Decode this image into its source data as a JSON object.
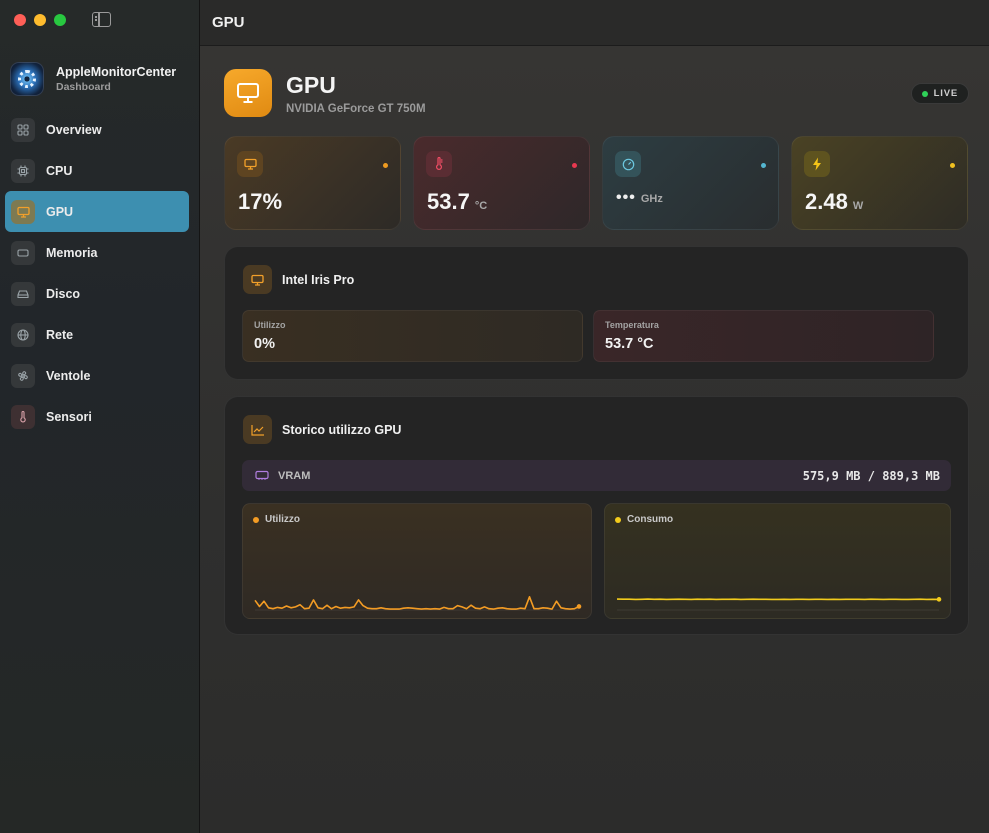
{
  "window": {
    "traffic_lights": [
      "close",
      "minimize",
      "zoom"
    ],
    "toolbar_title": "GPU"
  },
  "sidebar": {
    "app_name": "AppleMonitorCenter",
    "app_subtitle": "Dashboard",
    "items": [
      {
        "label": "Overview",
        "icon": "grid-icon",
        "active": false
      },
      {
        "label": "CPU",
        "icon": "cpu-chip-icon",
        "active": false
      },
      {
        "label": "GPU",
        "icon": "display-icon",
        "active": true
      },
      {
        "label": "Memoria",
        "icon": "memory-icon",
        "active": false
      },
      {
        "label": "Disco",
        "icon": "disk-icon",
        "active": false
      },
      {
        "label": "Rete",
        "icon": "globe-icon",
        "active": false
      },
      {
        "label": "Ventole",
        "icon": "fan-icon",
        "active": false
      },
      {
        "label": "Sensori",
        "icon": "thermometer-icon",
        "active": false
      }
    ]
  },
  "header": {
    "title": "GPU",
    "subtitle": "NVIDIA GeForce GT 750M",
    "live_badge": "LIVE"
  },
  "stats": [
    {
      "value": "17%",
      "unit": "",
      "icon": "display-icon",
      "accent": "#ee9b21"
    },
    {
      "value": "53.7",
      "unit": "°C",
      "icon": "thermometer-icon",
      "accent": "#e8384f"
    },
    {
      "value": "•••",
      "unit": "GHz",
      "icon": "gauge-icon",
      "accent": "#54b6d0"
    },
    {
      "value": "2.48",
      "unit": "W",
      "icon": "bolt-icon",
      "accent": "#f0c020"
    }
  ],
  "iris_card": {
    "title": "Intel Iris Pro",
    "utilizzo_label": "Utilizzo",
    "utilizzo_value": "0%",
    "temperatura_label": "Temperatura",
    "temperatura_value": "53.7 °C"
  },
  "history_card": {
    "title": "Storico utilizzo GPU",
    "vram_label": "VRAM",
    "vram_value": "575,9 MB / 889,3 MB",
    "utilizzo_label": "Utilizzo",
    "consumo_label": "Consumo"
  },
  "colors": {
    "accent_orange": "#f39c24",
    "accent_yellow": "#f2cb1c",
    "active_nav": "#3d8fb0",
    "live_green": "#2fd158"
  },
  "chart_data": [
    {
      "type": "line",
      "series": [
        {
          "name": "Utilizzo",
          "values": [
            22,
            8,
            20,
            5,
            3,
            6,
            4,
            9,
            5,
            7,
            12,
            3,
            4,
            23,
            5,
            3,
            11,
            3,
            8,
            4,
            6,
            5,
            7,
            23,
            10,
            4,
            3,
            3,
            5,
            3,
            2,
            2,
            2,
            4,
            5,
            4,
            3,
            2,
            3,
            2,
            3,
            2,
            6,
            3,
            3,
            10,
            7,
            3,
            11,
            4,
            3,
            7,
            3,
            2,
            4,
            5,
            3,
            2,
            2,
            4,
            3,
            30,
            3,
            3,
            5,
            4,
            2,
            20,
            5,
            3,
            2,
            3,
            8
          ]
        }
      ],
      "ylim": [
        0,
        100
      ]
    },
    {
      "type": "line",
      "series": [
        {
          "name": "Consumo",
          "values": [
            2.48,
            2.45,
            2.46,
            2.42,
            2.44,
            2.47,
            2.43,
            2.45,
            2.41,
            2.44,
            2.46,
            2.43,
            2.42,
            2.45,
            2.44,
            2.46,
            2.42,
            2.43,
            2.44,
            2.45,
            2.42,
            2.43,
            2.46,
            2.44,
            2.43,
            2.41,
            2.42,
            2.43,
            2.42,
            2.44,
            2.43,
            2.42,
            2.43,
            2.44,
            2.42,
            2.43,
            2.42,
            2.43,
            2.44,
            2.43,
            2.42,
            2.46,
            2.43,
            2.42,
            2.44,
            2.43,
            2.42,
            2.41,
            2.43,
            2.46,
            2.42,
            2.44,
            2.42
          ]
        }
      ],
      "ylim": [
        0,
        10
      ]
    }
  ]
}
